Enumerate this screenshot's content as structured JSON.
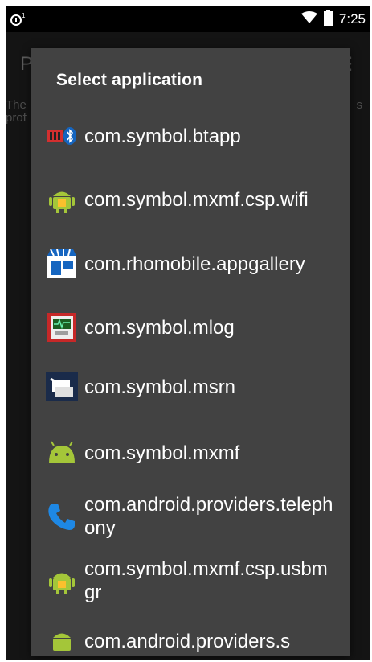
{
  "status_bar": {
    "time": "7:25",
    "left_icon": "notification-icon",
    "icons": [
      "wifi-icon",
      "battery-icon"
    ]
  },
  "background_app": {
    "title_fragment": "P",
    "text_line1": "The",
    "text_line2": "prof",
    "text_line3": "s",
    "menu_icon": "overflow-menu-icon"
  },
  "dialog": {
    "title": "Select application",
    "items": [
      {
        "label": "com.symbol.btapp",
        "icon": "bluetooth-app-icon"
      },
      {
        "label": "com.symbol.mxmf.csp.wifi",
        "icon": "android-package-icon"
      },
      {
        "label": "com.rhomobile.appgallery",
        "icon": "app-gallery-icon"
      },
      {
        "label": "com.symbol.mlog",
        "icon": "mlog-icon"
      },
      {
        "label": "com.symbol.msrn",
        "icon": "msrn-icon"
      },
      {
        "label": "com.symbol.mxmf",
        "icon": "android-icon"
      },
      {
        "label": "com.android.providers.telephony",
        "icon": "phone-icon"
      },
      {
        "label": "com.symbol.mxmf.csp.usbmgr",
        "icon": "android-package-icon"
      },
      {
        "label": "com.android.providers.s",
        "icon": "android-package-icon"
      }
    ]
  },
  "colors": {
    "dialog_bg": "#424242",
    "android_green": "#a4c639",
    "phone_blue": "#1e88e5"
  }
}
